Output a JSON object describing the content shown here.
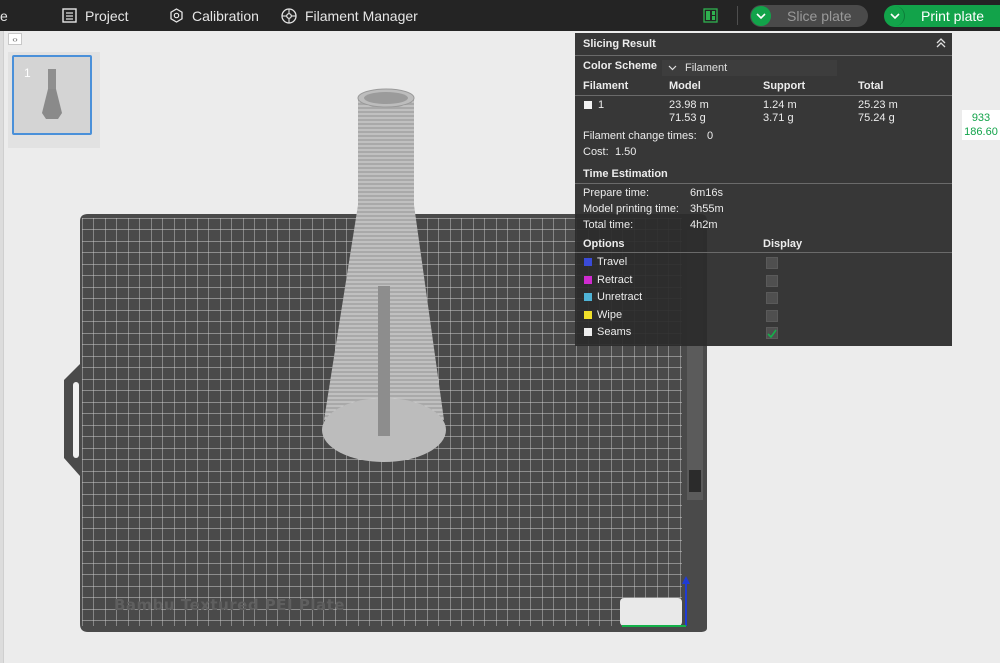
{
  "topbar": {
    "cut_label": "e",
    "project": "Project",
    "calibration": "Calibration",
    "filament_manager": "Filament Manager",
    "slice_plate": "Slice plate",
    "print_plate": "Print plate"
  },
  "plate": {
    "thumbnail_number": "1",
    "bed_label": "Bambu Textured PEI Plate"
  },
  "slicing_result": {
    "title": "Slicing Result",
    "color_scheme_label": "Color Scheme",
    "color_scheme_value": "Filament",
    "headers": {
      "filament": "Filament",
      "model": "Model",
      "support": "Support",
      "total": "Total"
    },
    "filament_row": {
      "id": "1",
      "model_length": "23.98 m",
      "model_weight": "71.53 g",
      "support_length": "1.24 m",
      "support_weight": "3.71 g",
      "total_length": "25.23 m",
      "total_weight": "75.24 g"
    },
    "filament_change_label": "Filament change times:",
    "filament_change_value": "0",
    "cost_label": "Cost:",
    "cost_value": "1.50"
  },
  "time_estimation": {
    "title": "Time Estimation",
    "prepare_label": "Prepare time:",
    "prepare_value": "6m16s",
    "model_print_label": "Model printing time:",
    "model_print_value": "3h55m",
    "total_label": "Total time:",
    "total_value": "4h2m"
  },
  "options": {
    "title": "Options",
    "display_label": "Display",
    "items": [
      {
        "label": "Travel",
        "color": "#3a4bd8",
        "checked": false
      },
      {
        "label": "Retract",
        "color": "#d02bd0",
        "checked": false
      },
      {
        "label": "Unretract",
        "color": "#4fb3d6",
        "checked": false
      },
      {
        "label": "Wipe",
        "color": "#f0e02a",
        "checked": false
      },
      {
        "label": "Seams",
        "color": "#eeeeee",
        "checked": true
      }
    ]
  },
  "axis_readout": {
    "line1": "933",
    "line2": "186.60"
  },
  "colors": {
    "accent_green": "#12a34a",
    "panel_bg": "#2c2c2c"
  }
}
